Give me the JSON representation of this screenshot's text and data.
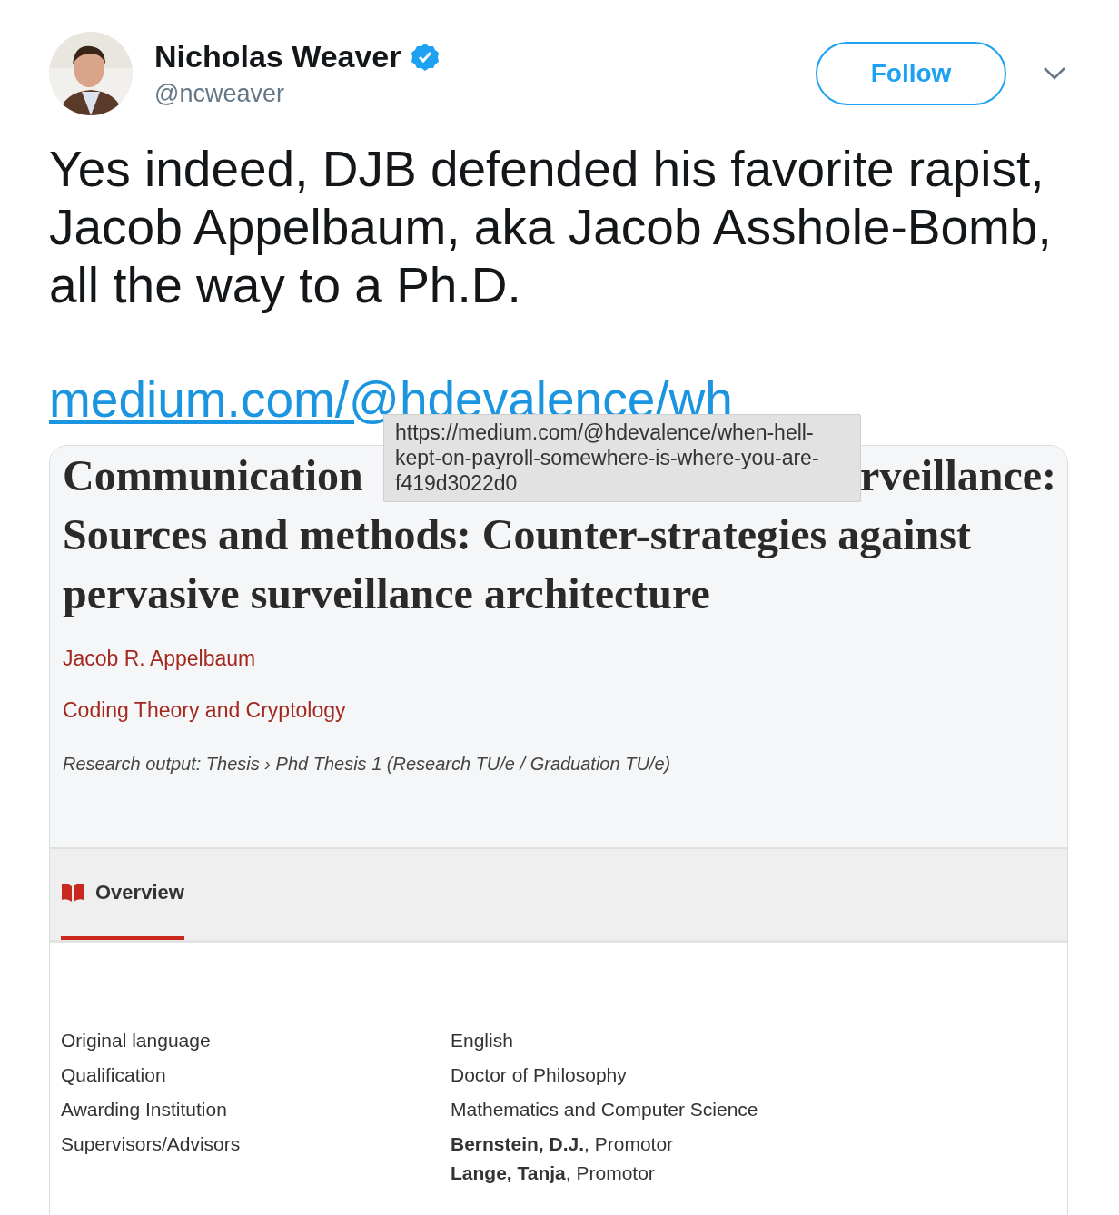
{
  "tweet": {
    "author": {
      "name": "Nicholas Weaver",
      "verified": true,
      "handle": "@ncweaver"
    },
    "follow_button": "Follow",
    "text": "Yes indeed, DJB defended his favorite rapist, Jacob Appelbaum, aka Jacob Asshole-Bomb, all the way to a Ph.D.",
    "link": "medium.com/@hdevalence/wh",
    "tooltip": "https://medium.com/@hdevalence/when-hell-kept-on-payroll-somewhere-is-where-you-are-f419d3022d0"
  },
  "embedded_page": {
    "title_line_1_left": "Communication",
    "title_line_1_right": "rveillance:",
    "title_rest": "Sources and methods: Counter-strategies against pervasive surveillance architecture",
    "author": "Jacob R. Appelbaum",
    "organisation": "Coding Theory and Cryptology",
    "research_output": "Research output: Thesis › Phd Thesis 1 (Research TU/e / Graduation TU/e)",
    "tabs": [
      {
        "label": "Overview",
        "selected": true
      }
    ],
    "details": [
      {
        "label": "Original language",
        "values": [
          "English"
        ]
      },
      {
        "label": "Qualification",
        "values": [
          "Doctor of Philosophy"
        ]
      },
      {
        "label": "Awarding Institution",
        "values": [
          "Mathematics and Computer Science"
        ]
      },
      {
        "label": "Supervisors/Advisors",
        "values": [
          "**Bernstein, D.J.**, Promotor",
          "**Lange, Tanja**, Promotor"
        ]
      }
    ]
  }
}
